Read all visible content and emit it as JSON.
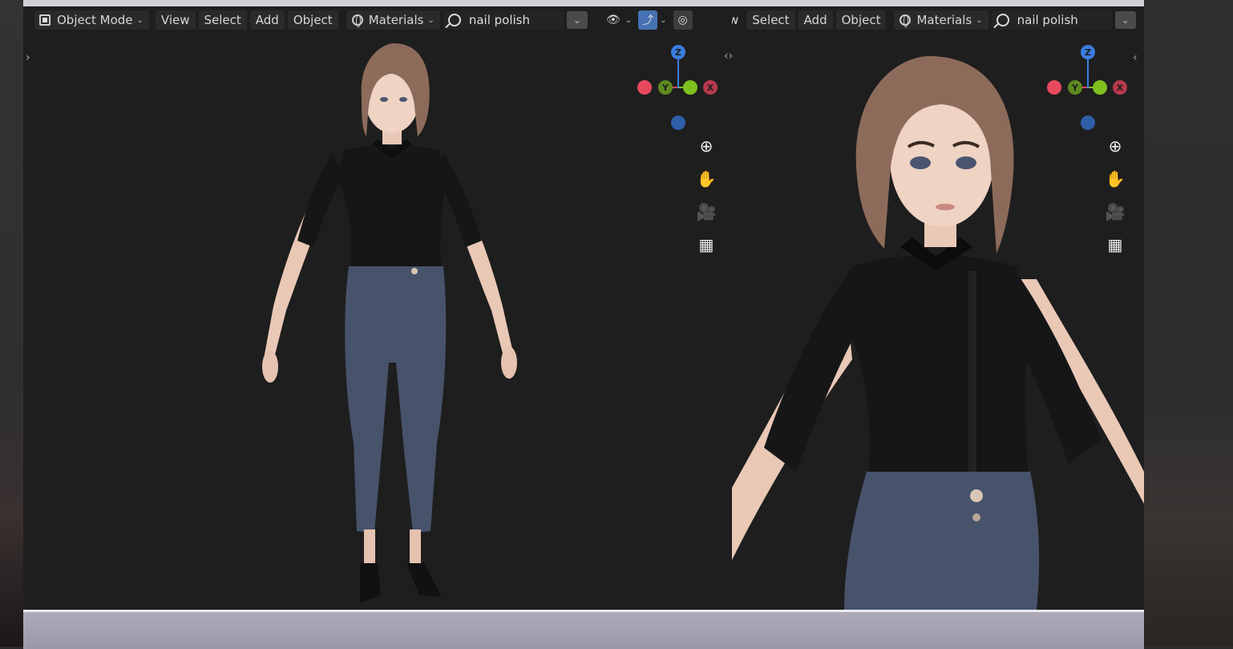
{
  "left_viewport": {
    "header": {
      "mode_label": "Object Mode",
      "menu": [
        "View",
        "Select",
        "Add",
        "Object"
      ],
      "shading_label": "Materials",
      "search_value": "nail polish"
    },
    "gizmo": {
      "z": "Z",
      "y": "Y",
      "x": "X"
    },
    "nav_tools": [
      "zoom-icon",
      "hand-icon",
      "camera-icon",
      "grid-icon"
    ]
  },
  "right_viewport": {
    "header": {
      "cut_label": "w",
      "menu": [
        "Select",
        "Add",
        "Object"
      ],
      "shading_label": "Materials",
      "search_value": "nail polish"
    },
    "gizmo": {
      "z": "Z",
      "y": "Y",
      "x": "X"
    },
    "nav_tools": [
      "zoom-icon",
      "hand-icon",
      "camera-icon",
      "grid-icon"
    ]
  },
  "colors": {
    "viewport_bg": "#1e1e1e",
    "x_axis": "#e8485e",
    "y_axis": "#7fbf20",
    "z_axis": "#3a7de0",
    "active_button": "#4772b3",
    "shirt": "#161616",
    "pants": "#47536b",
    "hair": "#8d6b5a",
    "skin": "#e9c8b6"
  }
}
